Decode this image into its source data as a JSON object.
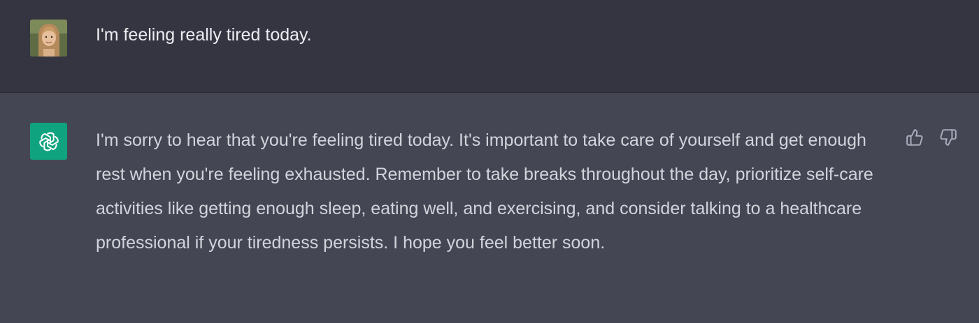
{
  "conversation": {
    "user_message": {
      "avatar_icon": "user-avatar-photo",
      "text": "I'm feeling really tired today."
    },
    "assistant_message": {
      "avatar_icon": "openai-logo-icon",
      "avatar_color": "#10a37f",
      "text": "I'm sorry to hear that you're feeling tired today. It's important to take care of yourself and get enough rest when you're feeling exhausted. Remember to take breaks throughout the day, prioritize self-care activities like getting enough sleep, eating well, and exercising, and consider talking to a healthcare professional if your tiredness persists. I hope you feel better soon.",
      "feedback": {
        "up_icon": "thumbs-up-icon",
        "down_icon": "thumbs-down-icon"
      }
    }
  },
  "colors": {
    "user_row_bg": "#343541",
    "assistant_row_bg": "#444654",
    "user_text": "#ececf1",
    "assistant_text": "#d1d5db"
  }
}
